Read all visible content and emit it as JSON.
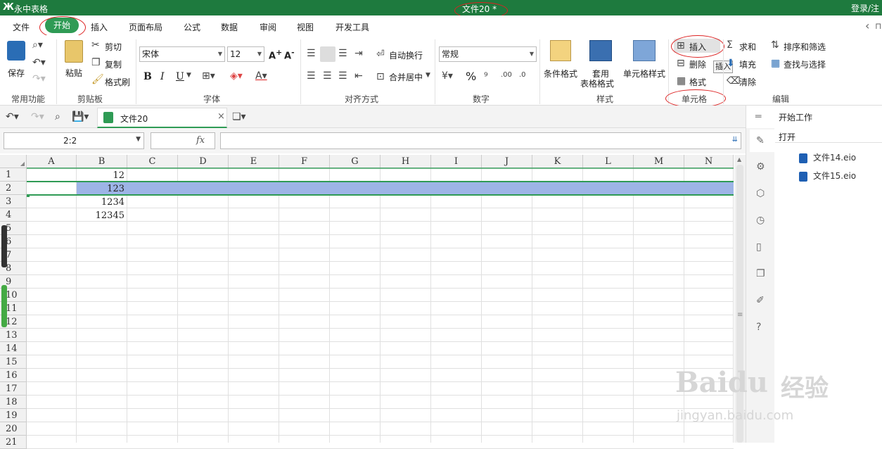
{
  "titlebar": {
    "logo": "Ж",
    "app": "永中表格",
    "doc": "文件20 *",
    "login": "登录/注"
  },
  "menu": {
    "items": [
      "文件",
      "开始",
      "插入",
      "页面布局",
      "公式",
      "数据",
      "审阅",
      "视图",
      "开发工具"
    ]
  },
  "ribbon": {
    "groups": {
      "common": "常用功能",
      "clipboard": "剪贴板",
      "font": "字体",
      "align": "对齐方式",
      "number": "数字",
      "style": "样式",
      "cells": "单元格",
      "edit": "编辑"
    },
    "save": "保存",
    "paste": "粘贴",
    "cut": "剪切",
    "copy": "复制",
    "format_painter": "格式刷",
    "font_name": "宋体",
    "font_size": "12",
    "bold": "B",
    "italic": "I",
    "underline": "U",
    "wrap": "自动换行",
    "merge": "合并居中",
    "number_format": "常规",
    "percent": "%",
    "cond_format": "条件格式",
    "table_format_1": "套用",
    "table_format_2": "表格格式",
    "cell_style": "单元格样式",
    "insert": "插入",
    "delete": "删除",
    "format": "格式",
    "tooltip": "插入",
    "sum": "求和",
    "fill": "填充",
    "clear": "清除",
    "sort_filter": "排序和筛选",
    "find_select": "查找与选择"
  },
  "doctab": {
    "name": "文件20"
  },
  "formula": {
    "name_box": "2:2",
    "fx": "fx"
  },
  "grid": {
    "columns": [
      "A",
      "B",
      "C",
      "D",
      "E",
      "F",
      "G",
      "H",
      "I",
      "J",
      "K",
      "L",
      "M",
      "N"
    ],
    "rows": [
      "1",
      "2",
      "3",
      "4",
      "5",
      "6",
      "7",
      "8",
      "9",
      "10",
      "11",
      "12",
      "13",
      "14",
      "15",
      "16",
      "17",
      "18",
      "19",
      "20",
      "21"
    ],
    "values": [
      "12",
      "123",
      "1234",
      "12345"
    ]
  },
  "sidebar": {
    "start": "开始工作",
    "open": "打开",
    "files": [
      "文件14.eio",
      "文件15.eio"
    ]
  },
  "watermark": {
    "brand": "Baidu",
    "cn": "经验",
    "url": "jingyan.baidu.com"
  },
  "colors": {
    "title_green": "#1e7a3e",
    "active_tab": "#2f9b55",
    "selection": "#9db4e6",
    "annotation_red": "#dd2222"
  }
}
